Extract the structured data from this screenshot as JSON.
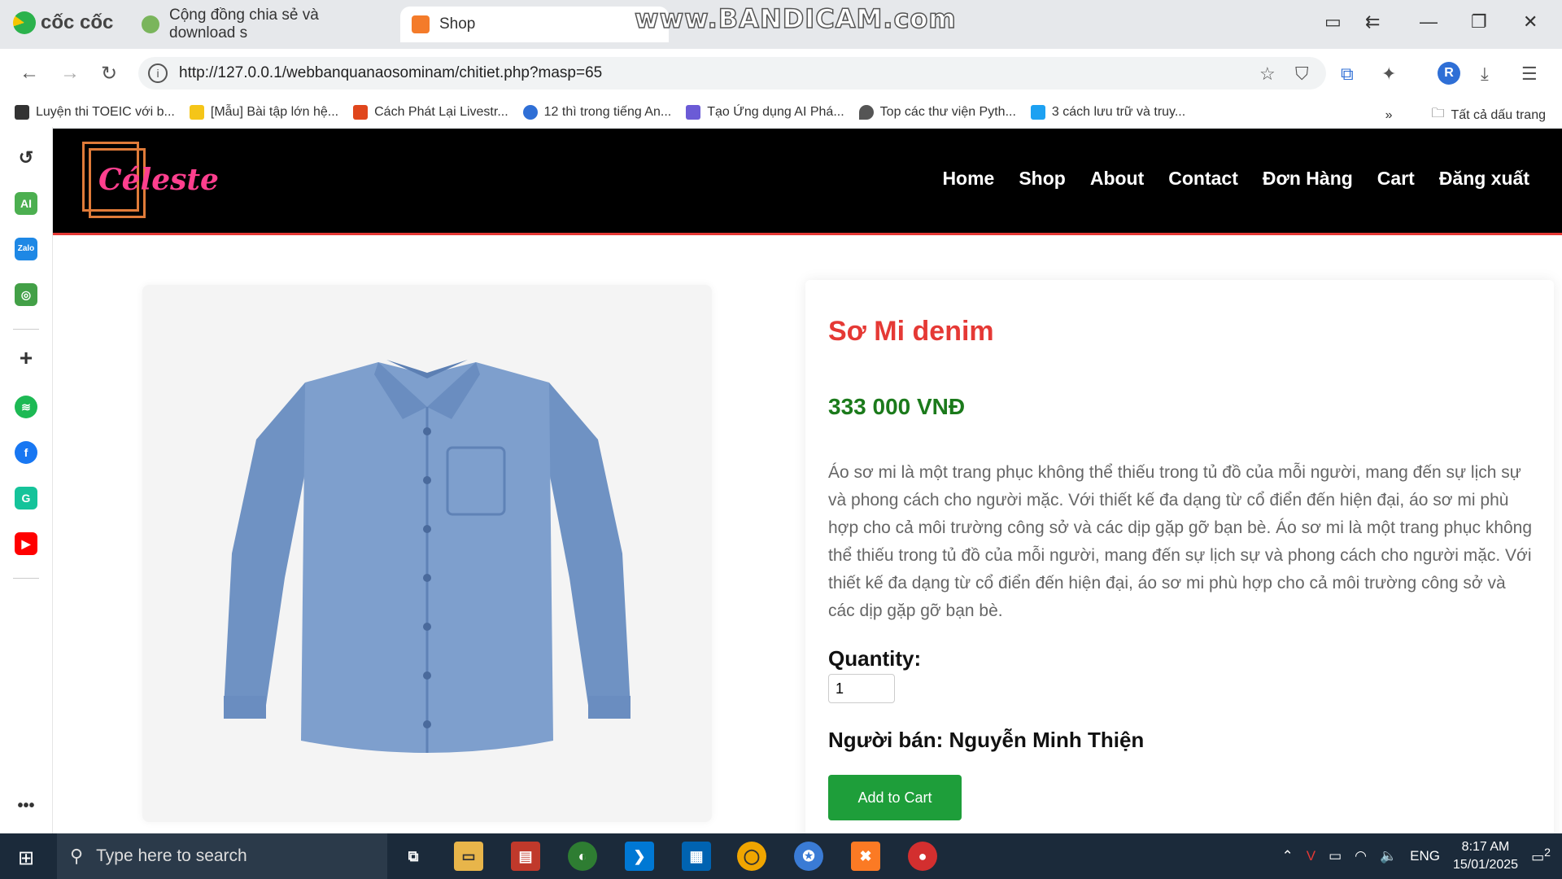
{
  "watermark": "www.BANDICAM.com",
  "browser": {
    "name": "cốc cốc",
    "tabs": [
      {
        "label": "Cộng đồng chia sẻ và download s"
      },
      {
        "label": "Shop"
      }
    ],
    "url": "http://127.0.0.1/webbanquanaosominam/chitiet.php?masp=65",
    "profile_initial": "R",
    "bookmarks": [
      "Luyện thi TOEIC với b...",
      "[Mẫu] Bài tập lớn hệ...",
      "Cách Phát Lại Livestr...",
      "12 thì trong tiếng An...",
      "Tạo Ứng dụng AI Phá...",
      "Top các thư viện Pyth...",
      "3 cách lưu trữ và truy..."
    ],
    "all_bookmarks": "Tất cả dấu trang"
  },
  "site": {
    "logo": "Céleste",
    "nav": [
      "Home",
      "Shop",
      "About",
      "Contact",
      "Đơn Hàng",
      "Cart",
      "Đăng xuất"
    ]
  },
  "product": {
    "title": "Sơ Mi denim",
    "price": "333 000 VNĐ",
    "description": "Áo sơ mi là một trang phục không thể thiếu trong tủ đồ của mỗi người, mang đến sự lịch sự và phong cách cho người mặc. Với thiết kế đa dạng từ cổ điển đến hiện đại, áo sơ mi phù hợp cho cả môi trường công sở và các dịp gặp gỡ bạn bè. Áo sơ mi là một trang phục không thể thiếu trong tủ đồ của mỗi người, mang đến sự lịch sự và phong cách cho người mặc. Với thiết kế đa dạng từ cổ điển đến hiện đại, áo sơ mi phù hợp cho cả môi trường công sở và các dịp gặp gỡ bạn bè.",
    "quantity_label": "Quantity:",
    "quantity_value": "1",
    "seller": "Người bán: Nguyễn Minh Thiện",
    "add_to_cart": "Add to Cart"
  },
  "taskbar": {
    "search_placeholder": "Type here to search",
    "language": "ENG",
    "time": "8:17 AM",
    "date": "15/01/2025",
    "notifications": "2"
  }
}
